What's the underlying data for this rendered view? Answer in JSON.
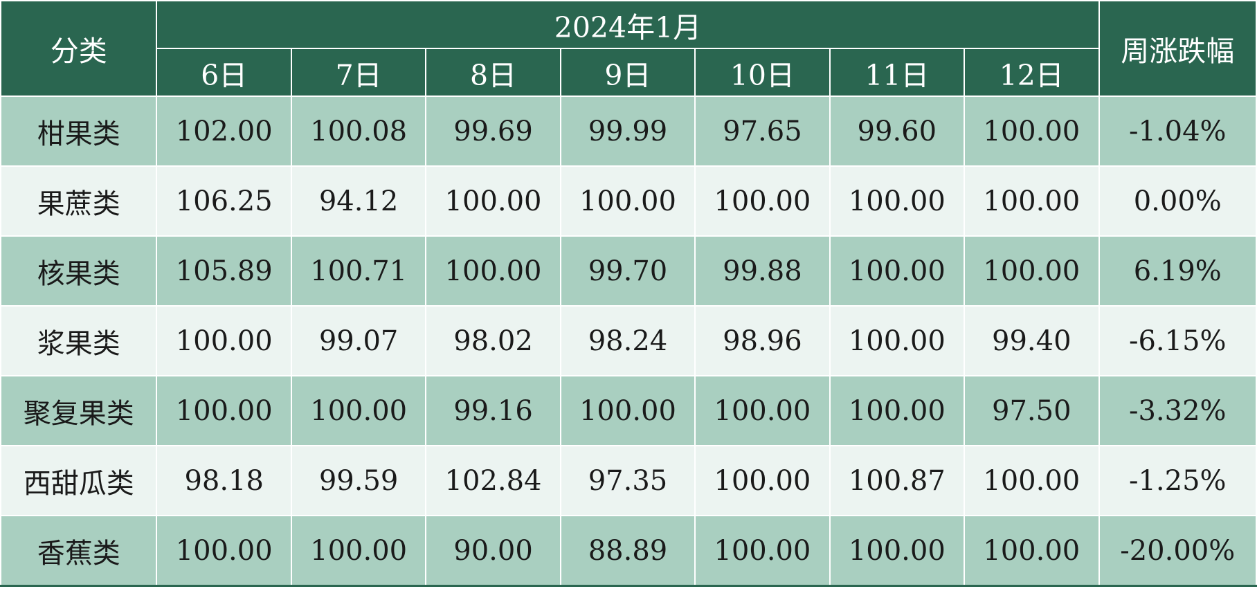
{
  "table": {
    "category_header": "分类",
    "month_header": "2024年1月",
    "change_header": "周涨跌幅",
    "day_headers": [
      "6日",
      "7日",
      "8日",
      "9日",
      "10日",
      "11日",
      "12日"
    ],
    "rows": [
      {
        "category": "柑果类",
        "values": [
          "102.00",
          "100.08",
          "99.69",
          "99.99",
          "97.65",
          "99.60",
          "100.00"
        ],
        "change": "-1.04%"
      },
      {
        "category": "果蔗类",
        "values": [
          "106.25",
          "94.12",
          "100.00",
          "100.00",
          "100.00",
          "100.00",
          "100.00"
        ],
        "change": "0.00%"
      },
      {
        "category": "核果类",
        "values": [
          "105.89",
          "100.71",
          "100.00",
          "99.70",
          "99.88",
          "100.00",
          "100.00"
        ],
        "change": "6.19%"
      },
      {
        "category": "浆果类",
        "values": [
          "100.00",
          "99.07",
          "98.02",
          "98.24",
          "98.96",
          "100.00",
          "99.40"
        ],
        "change": "-6.15%"
      },
      {
        "category": "聚复果类",
        "values": [
          "100.00",
          "100.00",
          "99.16",
          "100.00",
          "100.00",
          "100.00",
          "97.50"
        ],
        "change": "-3.32%"
      },
      {
        "category": "西甜瓜类",
        "values": [
          "98.18",
          "99.59",
          "102.84",
          "97.35",
          "100.00",
          "100.87",
          "100.00"
        ],
        "change": "-1.25%"
      },
      {
        "category": "香蕉类",
        "values": [
          "100.00",
          "100.00",
          "90.00",
          "88.89",
          "100.00",
          "100.00",
          "100.00"
        ],
        "change": "-20.00%"
      }
    ]
  },
  "colors": {
    "header_bg": "#2a6650",
    "row_dark": "#a9cfc0",
    "row_light": "#ecf4f1"
  }
}
